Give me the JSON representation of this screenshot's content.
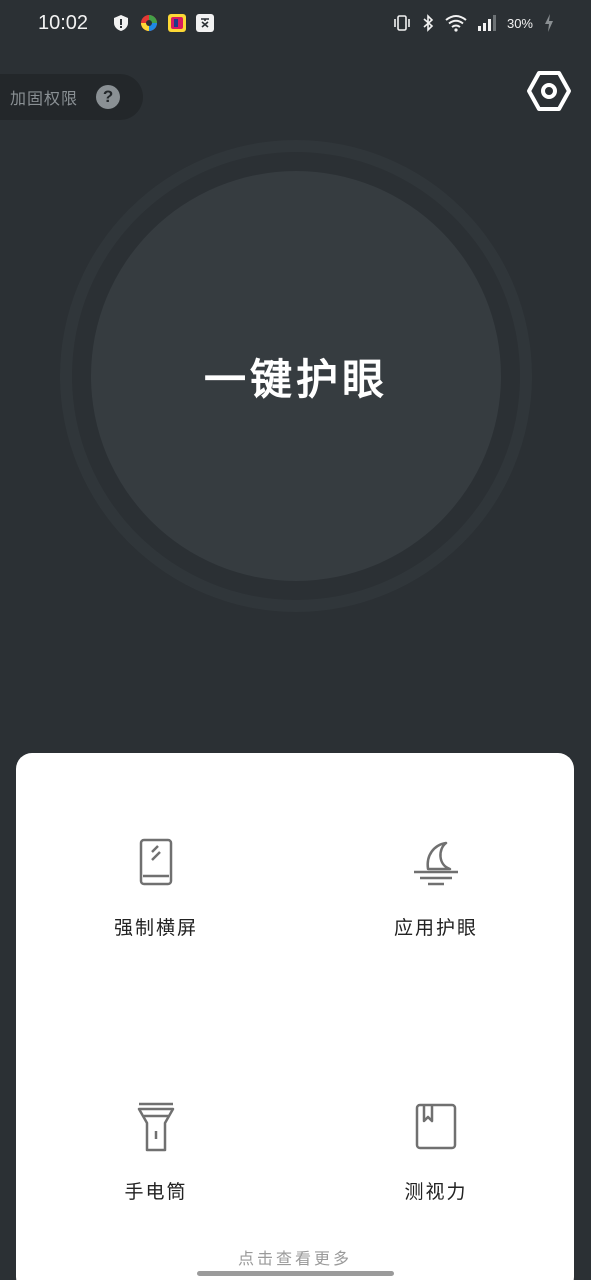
{
  "status_bar": {
    "time": "10:02",
    "battery": "30%"
  },
  "header": {
    "permission_label": "加固权限",
    "help_glyph": "?",
    "settings_icon": "hex-nut-settings-icon"
  },
  "main": {
    "button_label": "一键护眼"
  },
  "features": [
    {
      "label": "强制横屏",
      "icon": "phone-rotate-icon"
    },
    {
      "label": "应用护眼",
      "icon": "moon-icon"
    },
    {
      "label": "手电筒",
      "icon": "flashlight-icon"
    },
    {
      "label": "测视力",
      "icon": "book-icon"
    }
  ],
  "footer": {
    "more_label": "点击查看更多"
  },
  "colors": {
    "background": "#2b3034",
    "card": "#ffffff",
    "icon_gray": "#707070"
  }
}
